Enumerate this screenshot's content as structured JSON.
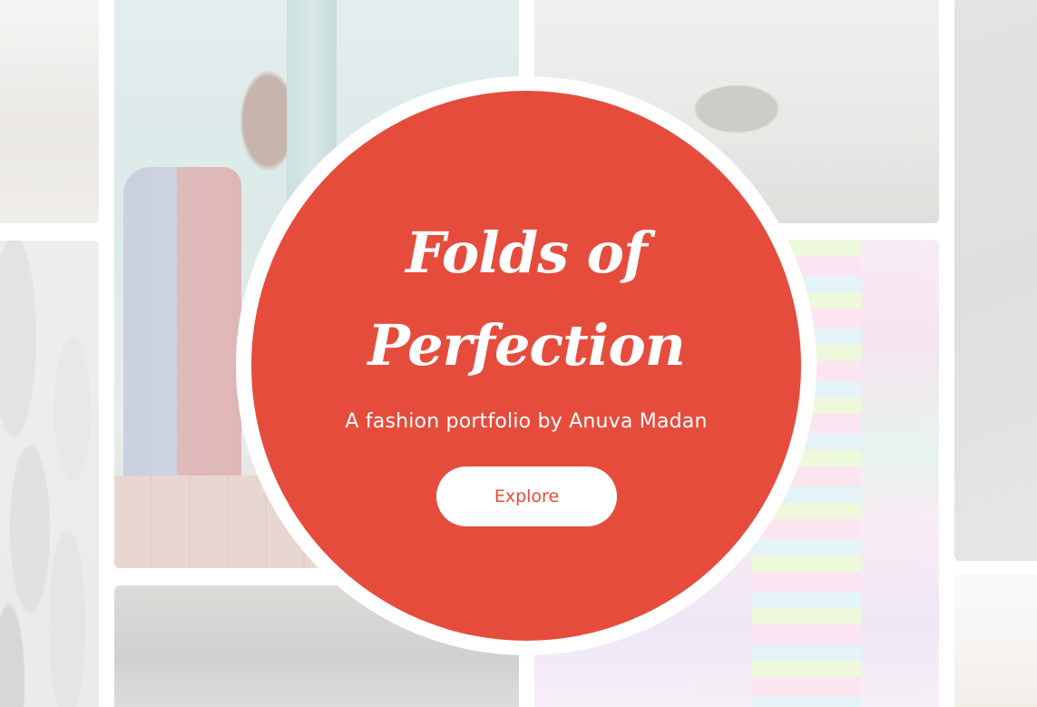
{
  "hero": {
    "title_line1": "Folds of",
    "title_line2": "Perfection",
    "subtitle": "A fashion portfolio by Anuva Madan",
    "cta_label": "Explore"
  },
  "colors": {
    "accent": "#e64c3c",
    "text_on_accent": "#ffffff",
    "ring": "#ffffff"
  },
  "gallery": [
    {
      "name": "gallery-tile-field"
    },
    {
      "name": "gallery-tile-stone-wall"
    },
    {
      "name": "gallery-tile-girl-with-goggles"
    },
    {
      "name": "gallery-tile-corridor"
    },
    {
      "name": "gallery-tile-woman-portrait"
    },
    {
      "name": "gallery-tile-colorful-fabric"
    },
    {
      "name": "gallery-tile-dark-portrait"
    },
    {
      "name": "gallery-tile-sand"
    }
  ]
}
